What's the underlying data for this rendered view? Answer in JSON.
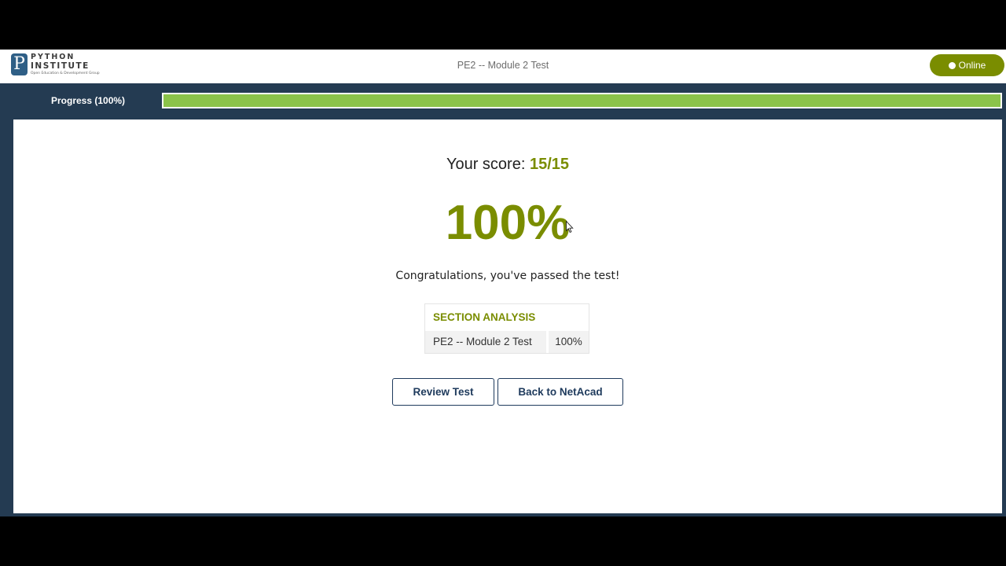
{
  "header": {
    "logo": {
      "line1": "PYTHON",
      "line2": "INSTITUTE",
      "tagline": "Open Education & Development Group",
      "mark": "P"
    },
    "title": "PE2 -- Module 2 Test",
    "status_label": "Online"
  },
  "progress": {
    "label": "Progress (100%)",
    "value": 1.0,
    "fill_color": "#8bc34a"
  },
  "result": {
    "score_prefix": "Your score:",
    "score_value": "15/15",
    "percent": "100%",
    "message": "Congratulations, you've passed the test!"
  },
  "section_analysis": {
    "title": "SECTION ANALYSIS",
    "rows": [
      {
        "name": "PE2 -- Module 2 Test",
        "value": "100%"
      }
    ]
  },
  "actions": {
    "review_label": "Review Test",
    "back_label": "Back to NetAcad"
  },
  "colors": {
    "accent": "#7a8d00",
    "frame": "#243b52",
    "button_border": "#1e3a5c"
  }
}
